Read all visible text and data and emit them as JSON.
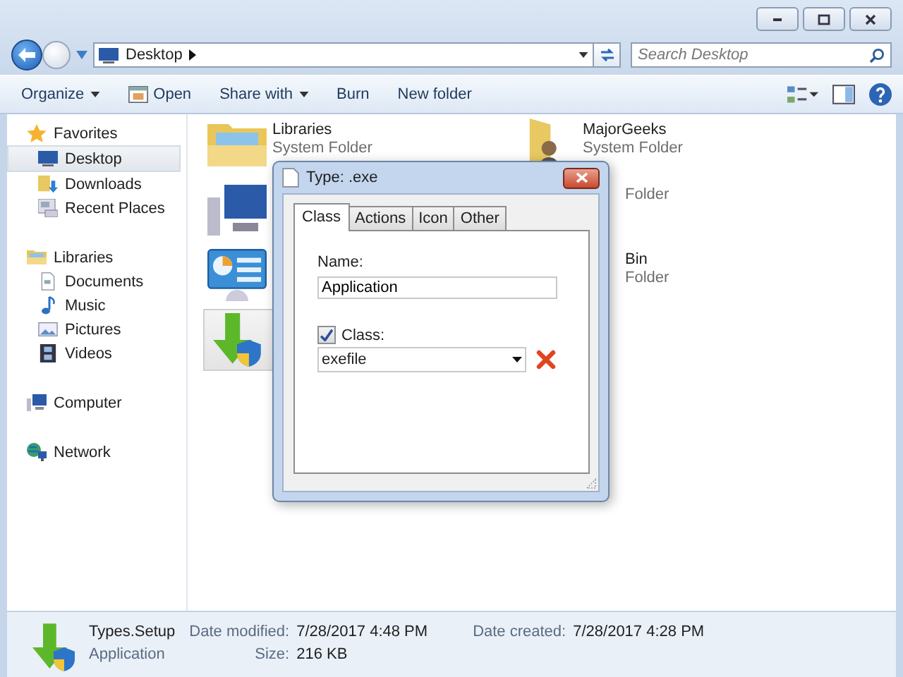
{
  "window": {
    "buttons": [
      {
        "kind": "minimize"
      },
      {
        "kind": "maximize"
      },
      {
        "kind": "close"
      }
    ]
  },
  "address_bar": {
    "location": "Desktop",
    "search_placeholder": "Search Desktop"
  },
  "toolbar": {
    "items": [
      {
        "label": "Organize",
        "kind": "menu"
      },
      {
        "label": "Open",
        "kind": "open"
      },
      {
        "label": "Share with",
        "kind": "menu"
      },
      {
        "label": "Burn",
        "kind": "plain"
      },
      {
        "label": "New folder",
        "kind": "plain"
      }
    ]
  },
  "sidebar": {
    "items": [
      {
        "label": "Favorites",
        "selected": false,
        "children": [
          {
            "label": "Desktop",
            "selected": true
          },
          {
            "label": "Downloads",
            "selected": false
          },
          {
            "label": "Recent Places",
            "selected": false
          }
        ]
      },
      {
        "label": "Libraries",
        "selected": false,
        "children": [
          {
            "label": "Documents",
            "selected": false
          },
          {
            "label": "Music",
            "selected": false
          },
          {
            "label": "Pictures",
            "selected": false
          },
          {
            "label": "Videos",
            "selected": false
          }
        ]
      },
      {
        "label": "Computer",
        "selected": false
      },
      {
        "label": "Network",
        "selected": false
      }
    ]
  },
  "files": {
    "columns": [
      [
        {
          "kind": "full",
          "name": "Libraries",
          "description": "System Folder",
          "selected": false
        },
        {
          "kind": "covered",
          "selected": false
        },
        {
          "kind": "covered",
          "selected": false
        },
        {
          "kind": "covered",
          "selected": true
        }
      ],
      [
        {
          "kind": "full",
          "name": "MajorGeeks",
          "description": "System Folder",
          "selected": false
        },
        {
          "kind": "partial",
          "description": "Folder",
          "selected": false
        },
        {
          "kind": "partial",
          "name": "Bin",
          "description": "Folder",
          "selected": false
        }
      ]
    ]
  },
  "dialog": {
    "title": "Type: .exe",
    "tabs": [
      {
        "label": "Class",
        "selected": true
      },
      {
        "label": "Actions",
        "selected": false
      },
      {
        "label": "Icon",
        "selected": false
      },
      {
        "label": "Other",
        "selected": false
      }
    ],
    "name_label": "Name:",
    "name_value": "Application",
    "class_checkbox": {
      "label": "Class:",
      "checked": true
    },
    "class_value": "exefile"
  },
  "details": {
    "name": "Types.Setup",
    "type": "Application",
    "fields": [
      {
        "label": "Date modified:",
        "value": "7/28/2017 4:48 PM"
      },
      {
        "label": "Size:",
        "value": "216 KB"
      }
    ],
    "fields_2": [
      {
        "label": "Date created:",
        "value": "7/28/2017 4:28 PM"
      }
    ]
  }
}
